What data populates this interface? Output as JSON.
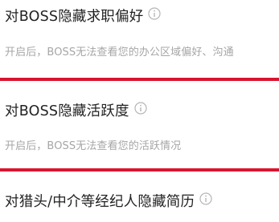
{
  "settings": [
    {
      "title": "对BOSS隐藏求职偏好",
      "description": "开启后，BOSS无法查看您的办公区域偏好、沟通"
    },
    {
      "title": "对BOSS隐藏活跃度",
      "description": "开启后，BOSS无法查看您的活跃情况"
    },
    {
      "title": "对猎头/中介等经纪人隐藏简历",
      "description": ""
    }
  ],
  "colors": {
    "highlight": "#d9152f",
    "title": "#222222",
    "description": "#a6a6a6",
    "icon": "#b5b5b5"
  },
  "icons": {
    "info": "info-circle-icon"
  }
}
